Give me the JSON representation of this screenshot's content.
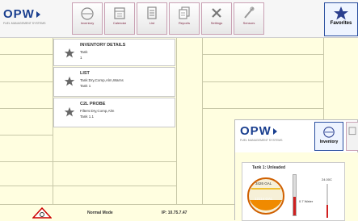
{
  "header": {
    "logo": "OPW",
    "logo_tagline": "FUEL MANAGEMENT SYSTEMS",
    "nav": [
      {
        "label": "Inventory",
        "icon": "drop-icon"
      },
      {
        "label": "Calendar",
        "icon": "calendar-icon"
      },
      {
        "label": "List",
        "icon": "list-icon"
      },
      {
        "label": "Reports",
        "icon": "reports-icon"
      },
      {
        "label": "Settings",
        "icon": "settings-icon"
      },
      {
        "label": "Sensors",
        "icon": "sensors-icon"
      },
      {
        "label": "Favorites",
        "icon": "star-icon",
        "active": true
      }
    ]
  },
  "favorites": [
    {
      "title": "INVENTORY DETAILS",
      "lines": [
        "Tank",
        "1"
      ]
    },
    {
      "title": "LIST",
      "lines": [
        "Tank:Dry,Comp,Alm,Warns",
        "Tank 1"
      ]
    },
    {
      "title": "C2L PROBE",
      "lines": [
        "Filters:Dry,Comp,Alm",
        "Tank 1.1"
      ]
    }
  ],
  "status": {
    "mode": "Normal Mode",
    "ip": "IP: 10.75.7.47"
  },
  "overlay": {
    "logo": "OPW",
    "logo_tagline": "FUEL MANAGEMENT SYSTEMS",
    "nav_label": "Inventory",
    "tank_title": "Tank 1: Unleaded",
    "gauge_top": "3426 GAL",
    "gauge_mid": "12114 GAL",
    "temp": "24.00C",
    "water": "0.7 Water"
  }
}
